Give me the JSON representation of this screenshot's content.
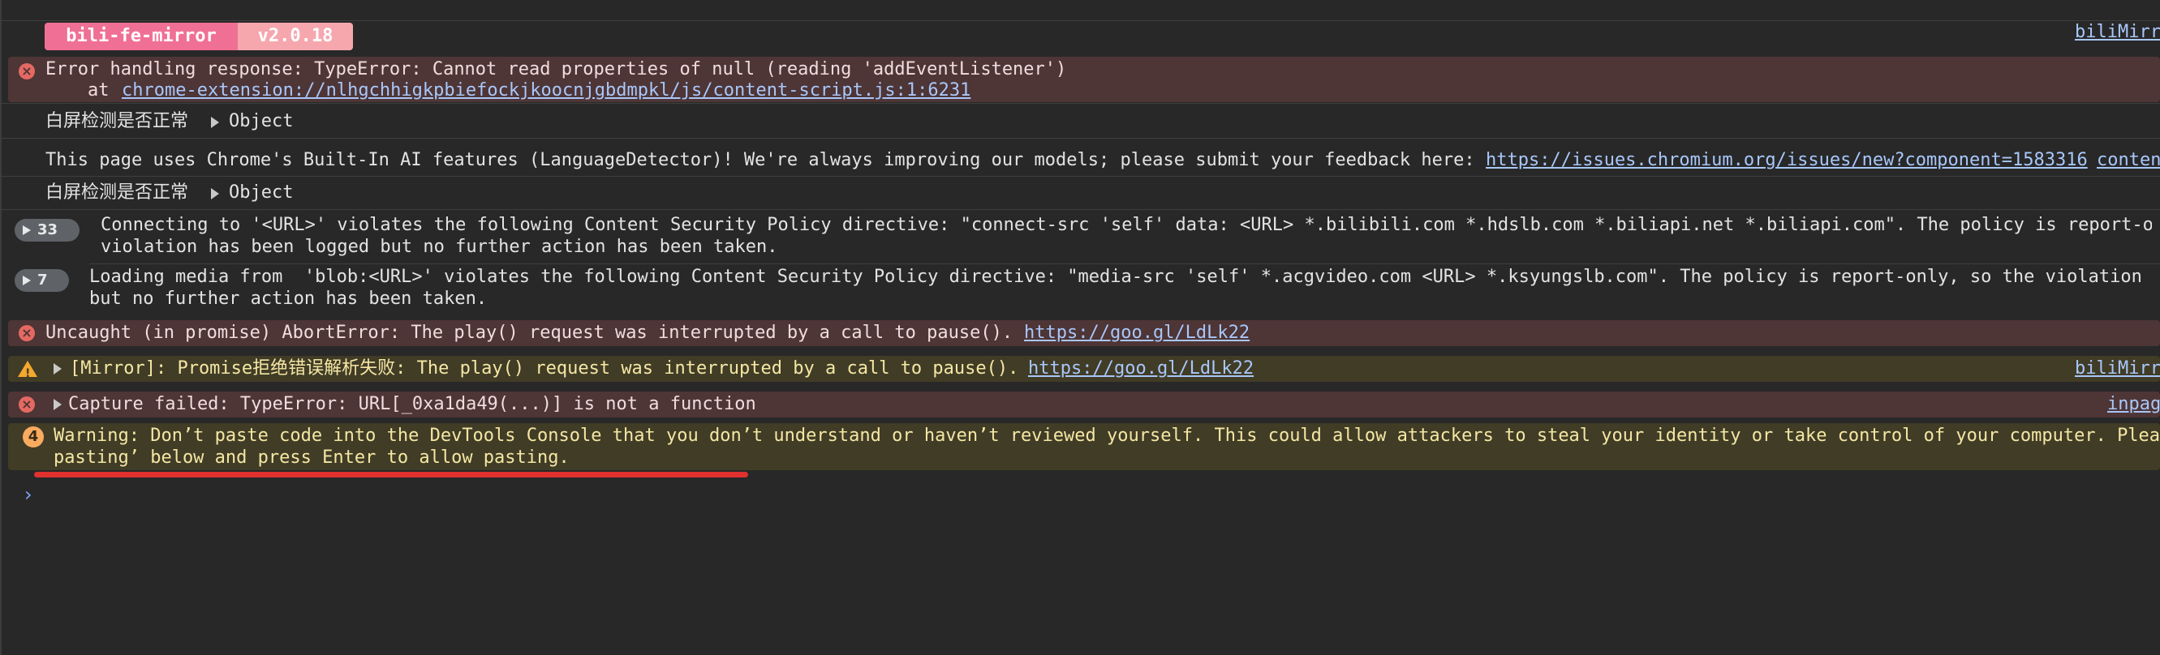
{
  "badge": {
    "name": "bili-fe-mirror",
    "version": "v2.0.18"
  },
  "source_links": {
    "row1": "biliMirr",
    "mirror_warning": "biliMirr",
    "capture": "inpag",
    "chromium_content": "conten"
  },
  "messages": {
    "error1_line1": "Error handling response: TypeError: Cannot read properties of null (reading 'addEventListener')",
    "error1_at": "at ",
    "error1_link": "chrome-extension://nlhgchhigkpbiefockjkoocnjgbdmpkl/js/content-script.js:1:6231",
    "log1_label": "白屏检测是否正常",
    "log1_object": "Object",
    "info_text": "This page uses Chrome's Built-In AI features (LanguageDetector)! We're always improving our models; please submit your feedback here: ",
    "info_link": "https://issues.chromium.org/issues/new?component=1583316",
    "log2_label": "白屏检测是否正常",
    "log2_object": "Object",
    "csp1_count": "33",
    "csp1_line1": "Connecting to '<URL>' violates the following Content Security Policy directive: \"connect-src 'self' data: <URL> *.bilibili.com *.hdslb.com *.biliapi.net *.biliapi.com\". The policy is report-on",
    "csp1_line2": "violation has been logged but no further action has been taken.",
    "csp2_count": "7",
    "csp2_line1": "Loading media from  'blob:<URL>' violates the following Content Security Policy directive: \"media-src 'self' *.acgvideo.com <URL> *.ksyungslb.com\". The policy is report-only, so the violation h",
    "csp2_line2": "but no further action has been taken.",
    "abort_text": "Uncaught (in promise) AbortError: The play() request was interrupted by a call to pause(). ",
    "abort_link": "https://goo.gl/LdLk22",
    "mirror_text": "[Mirror]: Promise拒绝错误解析失败: The play() request was interrupted by a call to pause(). ",
    "mirror_link": "https://goo.gl/LdLk22",
    "capture_text": "Capture failed: TypeError: URL[_0xa1da49(...)] is not a function",
    "paste_count": "4",
    "paste_line1": "Warning: Don’t paste code into the DevTools Console that you don’t understand or haven’t reviewed yourself. This could allow attackers to steal your identity or take control of your computer. Plea",
    "paste_line2": "pasting’ below and press Enter to allow pasting."
  },
  "prompt_symbol": "›",
  "colors": {
    "background": "#282828",
    "error_bg": "#4e3536",
    "warning_bg": "#413c26",
    "link": "#a8c7fa",
    "badge_pink": "#f06f95",
    "badge_light_pink": "#f6a7ae",
    "highlight_underline": "#e0312f"
  }
}
